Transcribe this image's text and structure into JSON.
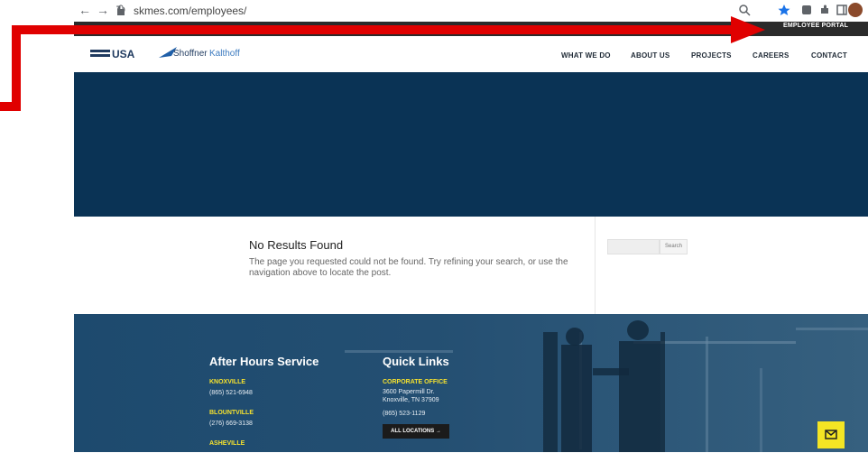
{
  "browser": {
    "url": "skmes.com/employees/"
  },
  "site": {
    "logo_left": "COMFORT SYSTEMS USA",
    "logo_right": "Shoffner Kalthoff",
    "portal_label": "EMPLOYEE PORTAL",
    "nav": [
      "WHAT WE DO",
      "ABOUT US",
      "PROJECTS",
      "CAREERS",
      "CONTACT"
    ]
  },
  "content": {
    "title": "No Results Found",
    "text": "The page you requested could not be found. Try refining your search, or use the navigation above to locate the post.",
    "search_button": "Search"
  },
  "footer": {
    "col1_title": "After Hours Service",
    "col1": [
      {
        "city": "KNOXVILLE",
        "phone": "(865) 521-6948"
      },
      {
        "city": "BLOUNTVILLE",
        "phone": "(276) 669-3138"
      },
      {
        "city": "ASHEVILLE",
        "phone": ""
      }
    ],
    "col2_title": "Quick Links",
    "corp_label": "CORPORATE OFFICE",
    "corp_addr1": "3600 Papermill Dr.",
    "corp_addr2": "Knoxville, TN 37909",
    "corp_phone": "(865) 523-1129",
    "all_locations": "ALL LOCATIONS →"
  },
  "colors": {
    "hero": "#0a3355",
    "accent_yellow": "#f4e524",
    "annotation_red": "#e00000"
  }
}
